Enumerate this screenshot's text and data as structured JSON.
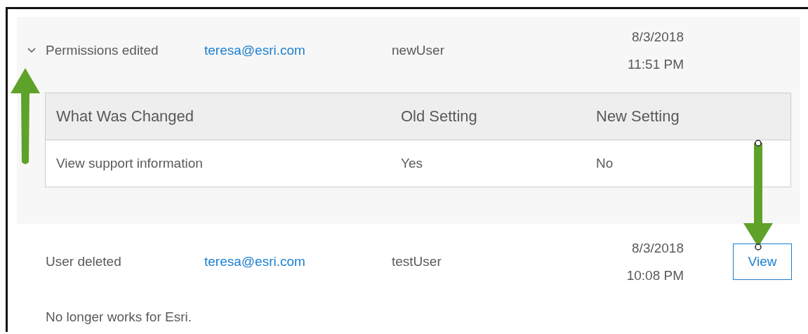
{
  "entries": [
    {
      "action": "Permissions edited",
      "email": "teresa@esri.com",
      "user": "newUser",
      "date": "8/3/2018",
      "time": "11:51 PM",
      "expanded": true,
      "changes": {
        "columns": [
          "What Was Changed",
          "Old Setting",
          "New Setting"
        ],
        "rows": [
          [
            "View support information",
            "Yes",
            "No"
          ]
        ]
      }
    },
    {
      "action": "User deleted",
      "email": "teresa@esri.com",
      "user": "testUser",
      "date": "8/3/2018",
      "time": "10:08 PM",
      "button": "View",
      "note": "No longer works for Esri."
    }
  ]
}
